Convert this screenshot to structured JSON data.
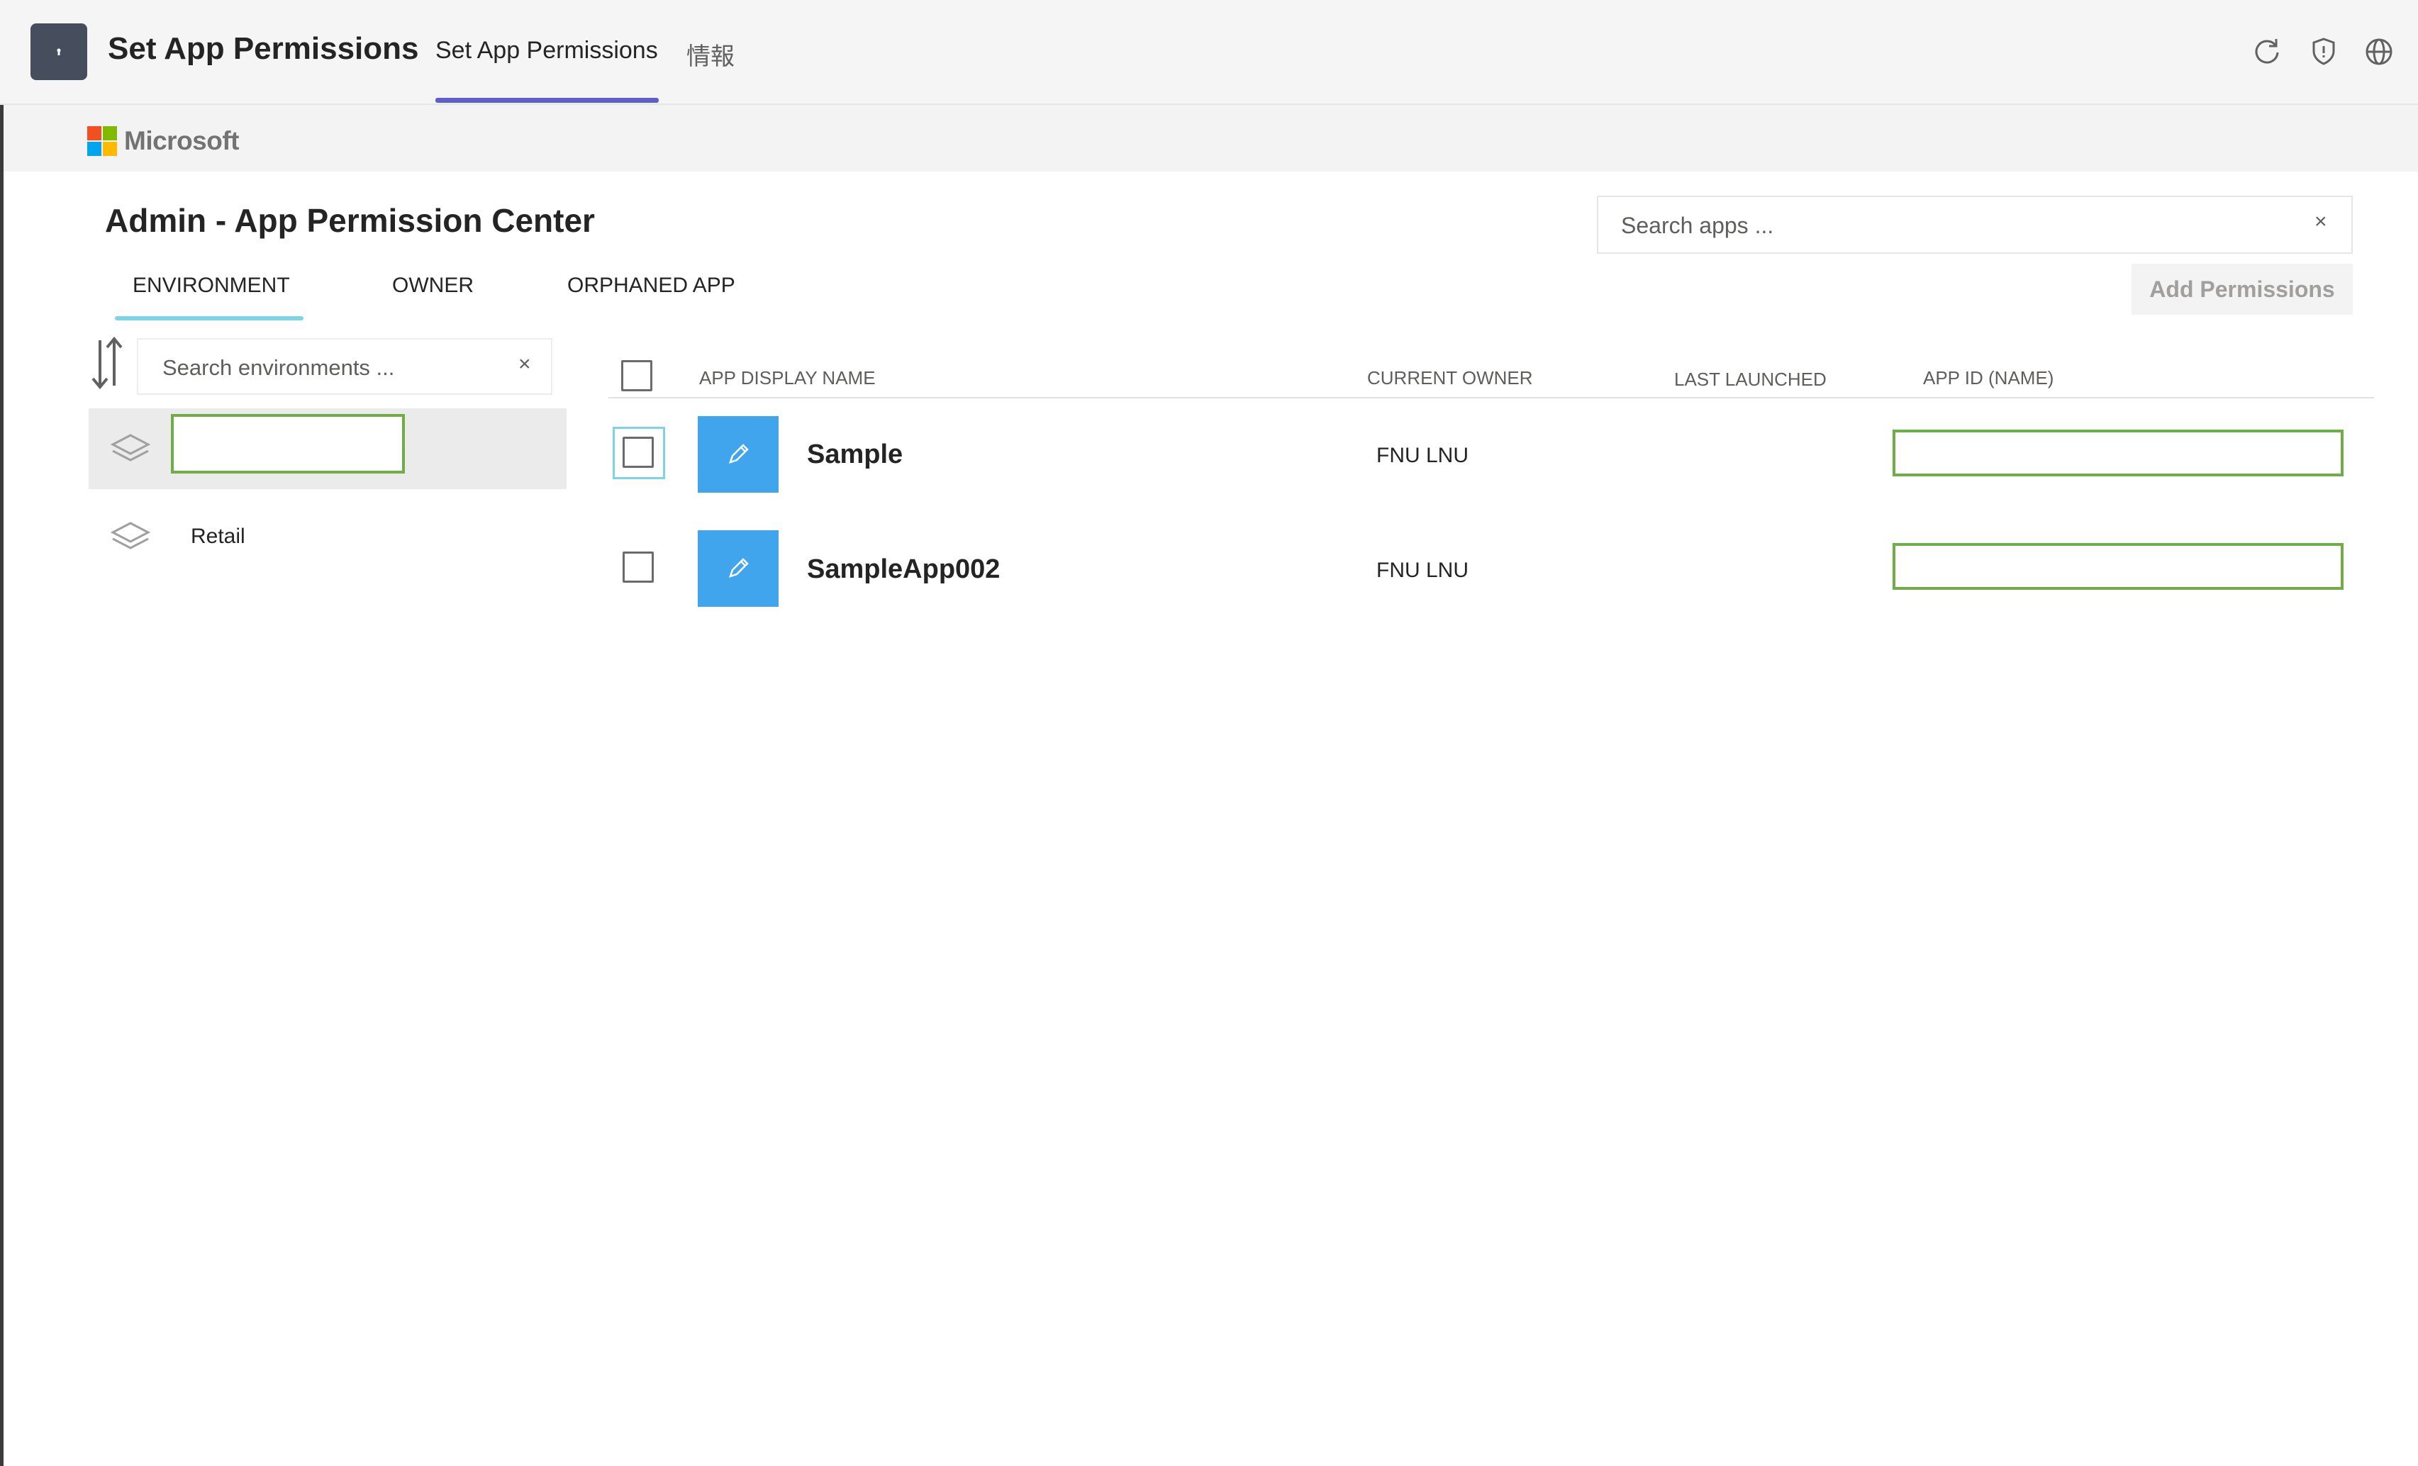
{
  "teams": {
    "app_title": "Set App Permissions",
    "tabs": [
      {
        "label": "Set App Permissions",
        "active": true
      },
      {
        "label": "情報",
        "active": false
      }
    ],
    "icons": [
      "refresh-icon",
      "shield-icon",
      "globe-icon"
    ]
  },
  "brand": {
    "name": "Microsoft",
    "colors": [
      "#f25022",
      "#7fba00",
      "#00a4ef",
      "#ffb900"
    ]
  },
  "page": {
    "title": "Admin - App Permission Center"
  },
  "search_apps": {
    "placeholder": "Search apps ...",
    "value": "",
    "clear_glyph": "×"
  },
  "filter_tabs": [
    {
      "label": "ENVIRONMENT",
      "active": true
    },
    {
      "label": "OWNER",
      "active": false
    },
    {
      "label": "ORPHANED APP",
      "active": false
    }
  ],
  "add_permissions_label": "Add Permissions",
  "environments": {
    "search_placeholder": "Search environments ...",
    "clear_glyph": "×",
    "items": [
      {
        "label": "",
        "selected": true,
        "editing": true
      },
      {
        "label": "Retail",
        "selected": false,
        "editing": false
      }
    ]
  },
  "table": {
    "columns": [
      "APP DISPLAY NAME",
      "CURRENT OWNER",
      "LAST LAUNCHED",
      "APP ID (NAME)"
    ],
    "rows": [
      {
        "name": "Sample",
        "owner": "FNU LNU",
        "last_launched": "",
        "app_id": ""
      },
      {
        "name": "SampleApp002",
        "owner": "FNU LNU",
        "last_launched": "",
        "app_id": ""
      }
    ]
  },
  "colors": {
    "accent_tab": "#5b5fc7",
    "tab_underline": "#7fd3e6",
    "app_tile": "#41a5ee",
    "edit_border": "#70ad47"
  }
}
